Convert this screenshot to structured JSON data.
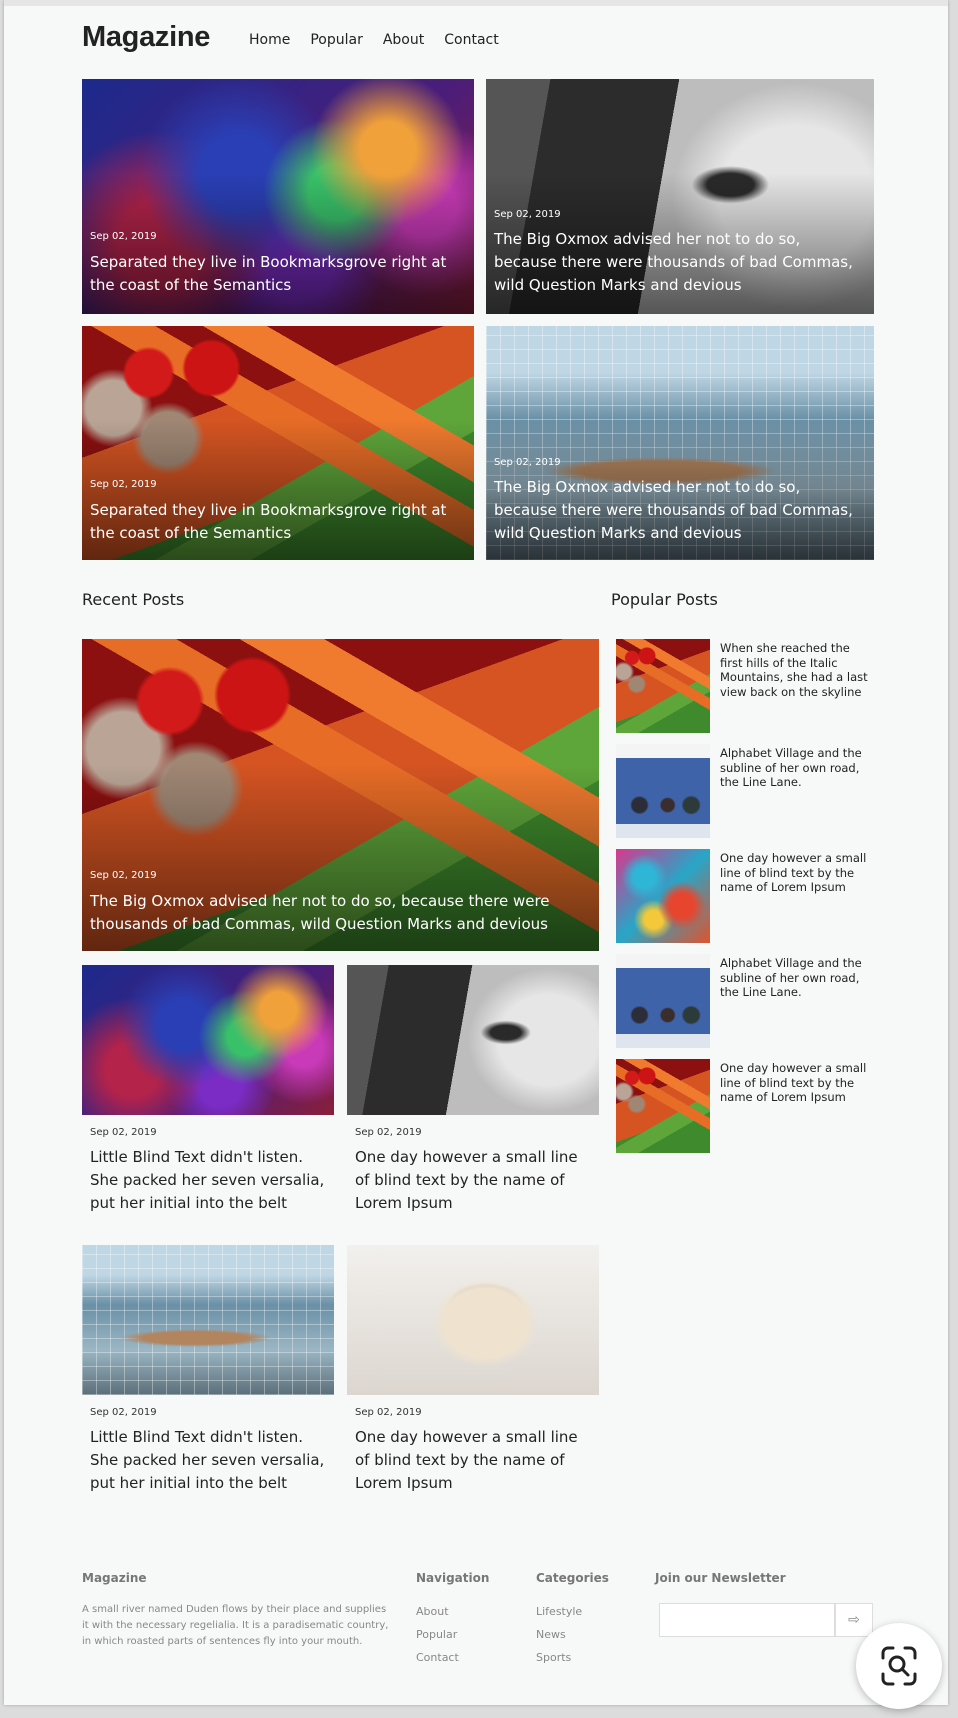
{
  "header": {
    "logo": "Magazine",
    "nav": [
      "Home",
      "Popular",
      "About",
      "Contact"
    ]
  },
  "hero": [
    {
      "date": "Sep 02, 2019",
      "title": "Separated they live in Bookmarksgrove right at the coast of the Semantics",
      "image": "abstract-colors"
    },
    {
      "date": "Sep 02, 2019",
      "title": "The Big Oxmox advised her not to do so, because there were thousands of bad Commas, wild Question Marks and devious",
      "image": "woman-eye-bw"
    },
    {
      "date": "Sep 02, 2019",
      "title": "Separated they live in Bookmarksgrove right at the coast of the Semantics",
      "image": "vegetables"
    },
    {
      "date": "Sep 02, 2019",
      "title": "The Big Oxmox advised her not to do so, because there were thousands of bad Commas, wild Question Marks and devious",
      "image": "swimmer"
    }
  ],
  "recent": {
    "heading": "Recent Posts",
    "featured": {
      "date": "Sep 02, 2019",
      "title": "The Big Oxmox advised her not to do so, because there were thousands of bad Commas, wild Question Marks and devious",
      "image": "vegetables"
    },
    "cards": [
      {
        "date": "Sep 02, 2019",
        "title": "Little Blind Text didn't listen. She packed her seven versalia, put her initial into the belt",
        "image": "abstract-colors"
      },
      {
        "date": "Sep 02, 2019",
        "title": "One day however a small line of blind text by the name of Lorem Ipsum",
        "image": "woman-eye-bw"
      },
      {
        "date": "Sep 02, 2019",
        "title": "Little Blind Text didn't listen. She packed her seven versalia, put her initial into the belt",
        "image": "swimmer"
      },
      {
        "date": "Sep 02, 2019",
        "title": "One day however a small line of blind text by the name of Lorem Ipsum",
        "image": "cat"
      }
    ]
  },
  "popular": {
    "heading": "Popular Posts",
    "items": [
      {
        "title": "When she reached the first hills of the Italic Mountains, she had a last view back on the skyline",
        "image": "vegetables"
      },
      {
        "title": "Alphabet Village and the subline of her own road, the Line Lane.",
        "image": "village"
      },
      {
        "title": "One day however a small line of blind text by the name of Lorem Ipsum",
        "image": "paint"
      },
      {
        "title": "Alphabet Village and the subline of her own road, the Line Lane.",
        "image": "village"
      },
      {
        "title": "One day however a small line of blind text by the name of Lorem Ipsum",
        "image": "vegetables"
      }
    ]
  },
  "footer": {
    "brand": "Magazine",
    "about": "A small river named Duden flows by their place and supplies it with the necessary regelialia. It is a paradisematic country, in which roasted parts of sentences fly into your mouth.",
    "navigation": {
      "heading": "Navigation",
      "links": [
        "About",
        "Popular",
        "Contact"
      ]
    },
    "categories": {
      "heading": "Categories",
      "links": [
        "Lifestyle",
        "News",
        "Sports"
      ]
    },
    "newsletter": {
      "heading": "Join our Newsletter",
      "placeholder": "",
      "button_icon": "arrow-right-icon"
    }
  },
  "floating": {
    "icon": "visual-search-icon"
  }
}
